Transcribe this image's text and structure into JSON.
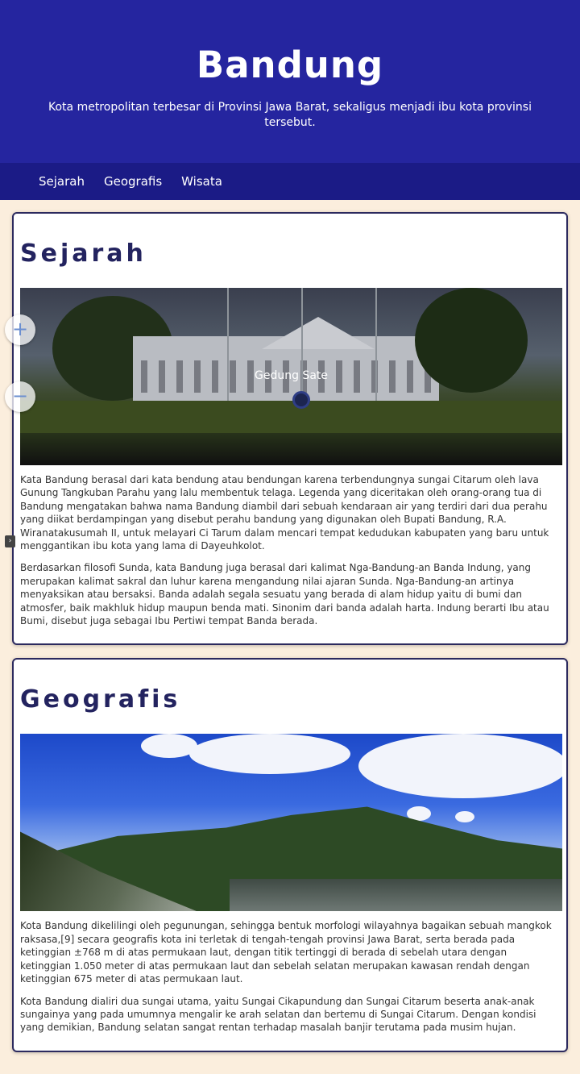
{
  "header": {
    "title": "Bandung",
    "subtitle": "Kota metropolitan terbesar di Provinsi Jawa Barat, sekaligus menjadi ibu kota provinsi tersebut."
  },
  "nav": {
    "items": [
      {
        "label": "Sejarah"
      },
      {
        "label": "Geografis"
      },
      {
        "label": "Wisata"
      }
    ]
  },
  "sections": [
    {
      "heading": "Sejarah",
      "image_caption": "Gedung Sate",
      "paragraphs": [
        "Kata Bandung berasal dari kata bendung atau bendungan karena terbendungnya sungai Citarum oleh lava Gunung Tangkuban Parahu yang lalu membentuk telaga. Legenda yang diceritakan oleh orang-orang tua di Bandung mengatakan bahwa nama Bandung diambil dari sebuah kendaraan air yang terdiri dari dua perahu yang diikat berdampingan yang disebut perahu bandung yang digunakan oleh Bupati Bandung, R.A. Wiranatakusumah II, untuk melayari Ci Tarum dalam mencari tempat kedudukan kabupaten yang baru untuk menggantikan ibu kota yang lama di Dayeuhkolot.",
        "Berdasarkan filosofi Sunda, kata Bandung juga berasal dari kalimat Nga-Bandung-an Banda Indung, yang merupakan kalimat sakral dan luhur karena mengandung nilai ajaran Sunda. Nga-Bandung-an artinya menyaksikan atau bersaksi. Banda adalah segala sesuatu yang berada di alam hidup yaitu di bumi dan atmosfer, baik makhluk hidup maupun benda mati. Sinonim dari banda adalah harta. Indung berarti Ibu atau Bumi, disebut juga sebagai Ibu Pertiwi tempat Banda berada."
      ]
    },
    {
      "heading": "Geografis",
      "paragraphs": [
        "Kota Bandung dikelilingi oleh pegunungan, sehingga bentuk morfologi wilayahnya bagaikan sebuah mangkok raksasa,[9] secara geografis kota ini terletak di tengah-tengah provinsi Jawa Barat, serta berada pada ketinggian ±768 m di atas permukaan laut, dengan titik tertinggi di berada di sebelah utara dengan ketinggian 1.050 meter di atas permukaan laut dan sebelah selatan merupakan kawasan rendah dengan ketinggian 675 meter di atas permukaan laut.",
        "Kota Bandung dialiri dua sungai utama, yaitu Sungai Cikapundung dan Sungai Citarum beserta anak-anak sungainya yang pada umumnya mengalir ke arah selatan dan bertemu di Sungai Citarum. Dengan kondisi yang demikian, Bandung selatan sangat rentan terhadap masalah banjir terutama pada musim hujan."
      ]
    }
  ],
  "controls": {
    "zoom_in": "+",
    "zoom_out": "−",
    "side_tab": "›"
  },
  "colors": {
    "header_bg": "#25259f",
    "nav_bg": "#1b1b86",
    "page_bg": "#fbeedd",
    "heading": "#23235f"
  }
}
